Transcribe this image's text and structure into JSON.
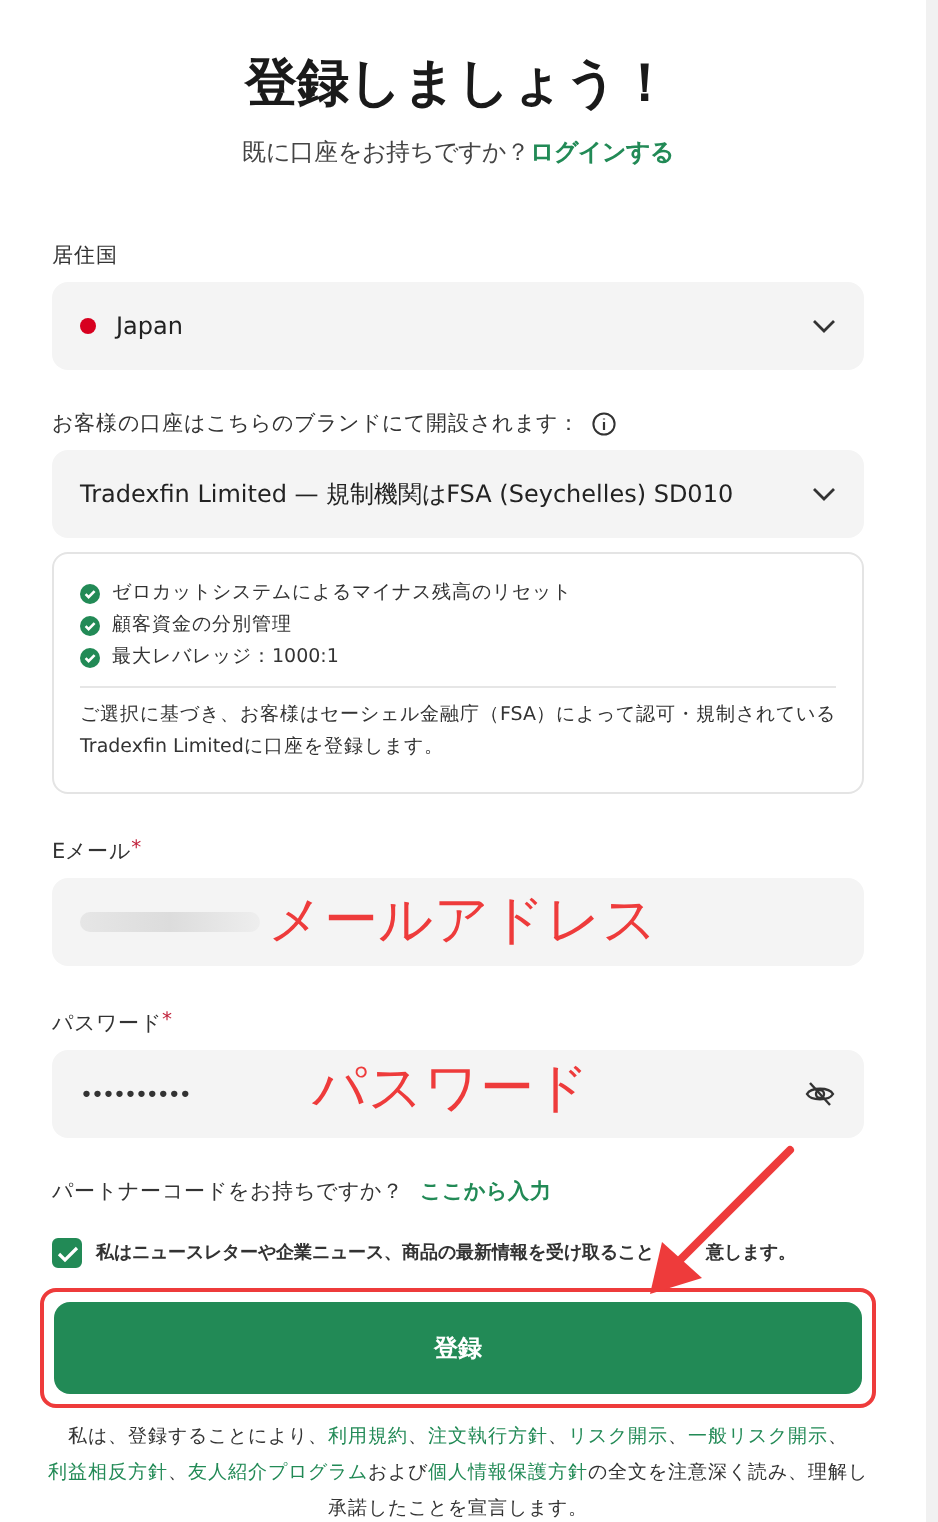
{
  "title": "登録しましょう！",
  "login_prompt": {
    "text": "既に口座をお持ちですか？",
    "link": "ログインする"
  },
  "country": {
    "label": "居住国",
    "value": "Japan"
  },
  "brand": {
    "label": "お客様の口座はこちらのブランドにて開設されます：",
    "value": "Tradexfin Limited — 規制機関はFSA (Seychelles) SD010"
  },
  "features": [
    "ゼロカットシステムによるマイナス残高のリセット",
    "顧客資金の分別管理",
    "最大レバレッジ：1000:1"
  ],
  "notice": "ご選択に基づき、お客様はセーシェル金融庁（FSA）によって認可・規制されているTradexfin Limitedに口座を登録します。",
  "email": {
    "label": "Eメール",
    "required_mark": "*",
    "annotation": "メールアドレス"
  },
  "password": {
    "label": "パスワード",
    "required_mark": "*",
    "value": "••••••••••",
    "annotation": "パスワード"
  },
  "partner": {
    "text": "パートナーコードをお持ちですか？",
    "link": "ここから入力"
  },
  "newsletter": {
    "label_start": "私はニュースレターや企業ニュース、商品の最新情報を受け取ること",
    "label_end": "意します。",
    "checked": true
  },
  "submit": {
    "label": "登録",
    "highlighted": true
  },
  "legal": [
    {
      "kind": "text",
      "text": "私は、登録することにより、"
    },
    {
      "kind": "link",
      "text": "利用規約"
    },
    {
      "kind": "text",
      "text": "、"
    },
    {
      "kind": "link",
      "text": "注文執行方針"
    },
    {
      "kind": "text",
      "text": "、"
    },
    {
      "kind": "link",
      "text": "リスク開示"
    },
    {
      "kind": "text",
      "text": "、"
    },
    {
      "kind": "link",
      "text": "一般リスク開示"
    },
    {
      "kind": "text",
      "text": "、"
    },
    {
      "kind": "link",
      "text": "利益相反方針"
    },
    {
      "kind": "text",
      "text": "、"
    },
    {
      "kind": "link",
      "text": "友人紹介プログラム"
    },
    {
      "kind": "text",
      "text": "および"
    },
    {
      "kind": "link",
      "text": "個人情報保護方針"
    },
    {
      "kind": "text",
      "text": "の全文を注意深く読み、理解し承諾したことを宣言します。"
    }
  ]
}
